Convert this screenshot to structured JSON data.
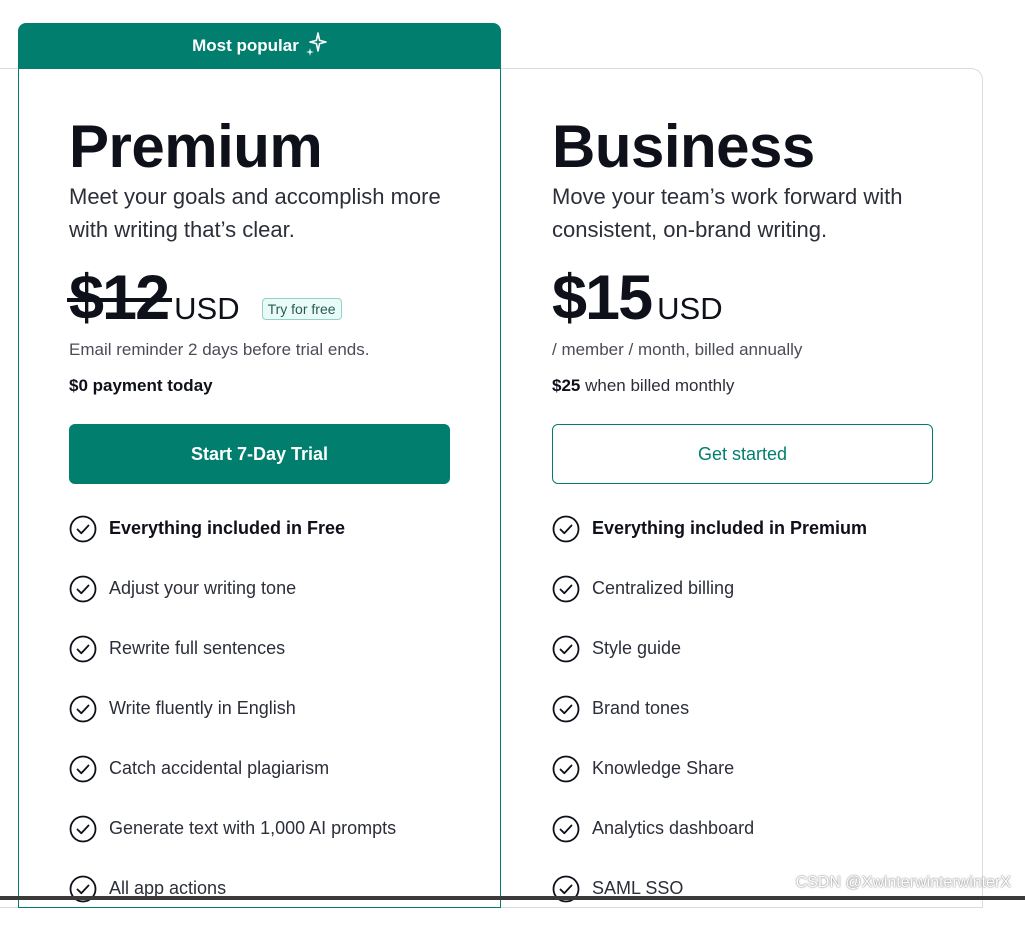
{
  "colors": {
    "accent": "#027e6f",
    "text": "#0e101a",
    "badge_bg": "#eafaf7"
  },
  "popular_tab": {
    "label": "Most popular",
    "icon": "sparkle-icon"
  },
  "premium": {
    "name": "Premium",
    "description": "Meet your goals and accomplish more with writing that’s clear.",
    "price": "$12",
    "currency": "USD",
    "badge": "Try for free",
    "note": "Email reminder 2 days before trial ends.",
    "payment": "$0 payment today",
    "cta": "Start 7-Day Trial",
    "features": [
      {
        "label": "Everything included in Free",
        "bold": true
      },
      {
        "label": "Adjust your writing tone"
      },
      {
        "label": "Rewrite full sentences"
      },
      {
        "label": "Write fluently in English"
      },
      {
        "label": "Catch accidental plagiarism"
      },
      {
        "label": "Generate text with 1,000 AI prompts"
      },
      {
        "label": "All app actions"
      }
    ]
  },
  "business": {
    "name": "Business",
    "description": "Move your team’s work forward with consistent, on-brand writing.",
    "price": "$15",
    "currency": "USD",
    "note": "/ member / month, billed annually",
    "monthly_price": "$25",
    "monthly_text": " when billed monthly",
    "cta": "Get started",
    "features": [
      {
        "label": "Everything included in Premium",
        "bold": true
      },
      {
        "label": "Centralized billing"
      },
      {
        "label": "Style guide"
      },
      {
        "label": "Brand tones"
      },
      {
        "label": "Knowledge Share"
      },
      {
        "label": "Analytics dashboard"
      },
      {
        "label": "SAML SSO"
      }
    ]
  },
  "watermark": "CSDN @XwinterwinterwinterX"
}
